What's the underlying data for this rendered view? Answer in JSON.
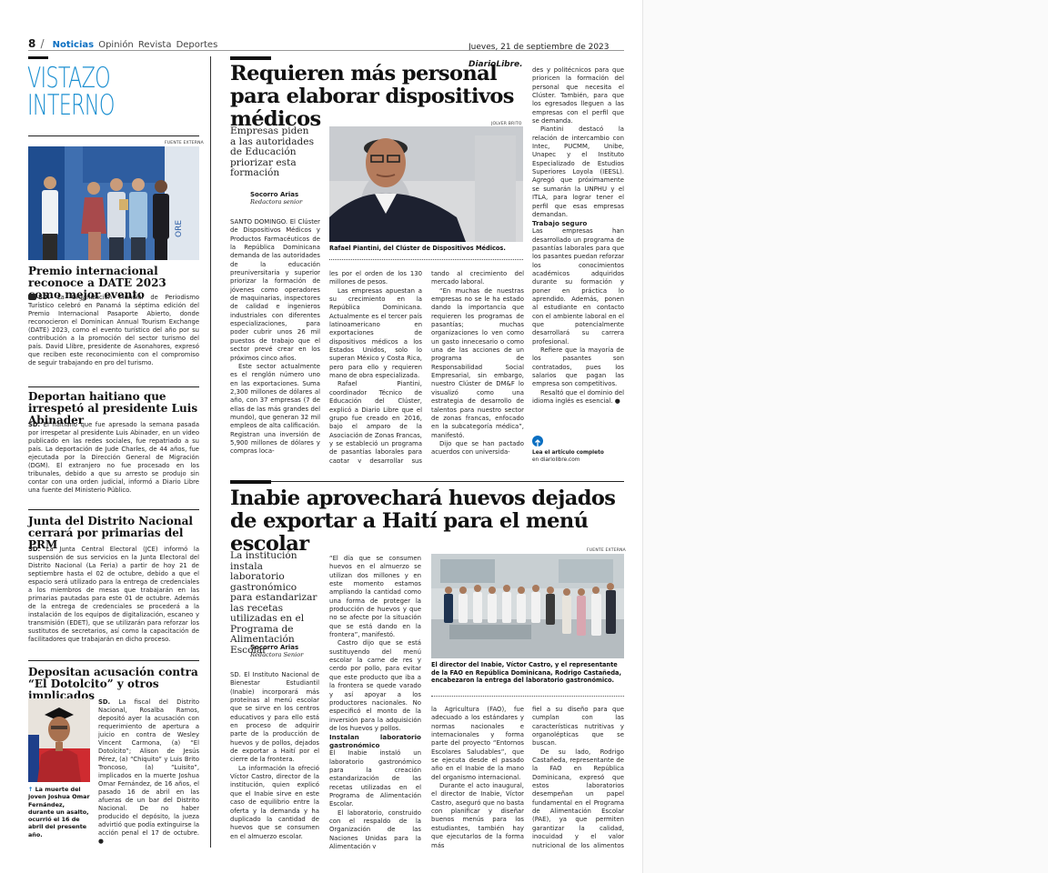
{
  "header": {
    "page_number": "8",
    "page_slash": "/",
    "nav": [
      "Noticias",
      "Opinión",
      "Revista",
      "Deportes"
    ],
    "date": "Jueves, 21 de septiembre de 2023",
    "brand": "DiarioLibre."
  },
  "sidebar": {
    "section_title_line1": "VISTAZO",
    "section_title_line2": "INTERNO",
    "photo_credit": "FUENTE EXTERNA",
    "stories": [
      {
        "headline": "Premio internacional reconoce a DATE 2023 como mejor evento",
        "tag": "SD.",
        "body": "La Organización Mundial de Periodismo Turístico celebró en Panamá la séptima edición del Premio Internacional Pasaporte Abierto, donde reconocieron el Dominican Annual Tourism Exchange (DATE) 2023, como el evento turístico del año por su contribución a la promoción del sector turismo del país. David Llibre, presidente de Asonahores, expresó que reciben este reconocimiento con el compromiso de seguir trabajando en pro del turismo."
      },
      {
        "headline": "Deportan haitiano que irrespetó al presidente Luis Abinader",
        "tag": "SD.",
        "body": "El haitiano que fue apresado la semana pasada por irrespetar al presidente Luis Abinader, en un video publicado en las redes sociales, fue repatriado a su país. La deportación de Jude Charles, de 44 años, fue ejecutada por la Dirección General de Migración (DGM). El extranjero no fue procesado en los tribunales, debido a que su arresto se produjo sin contar con una orden judicial, informó a Diario Libre una fuente del Ministerio Público."
      },
      {
        "headline": "Junta del Distrito Nacional cerrará por primarias del PRM",
        "tag": "SD.",
        "body": "La Junta Central Electoral (JCE) informó la suspensión de sus servicios en la Junta Electoral del Distrito Nacional (La Feria) a partir de hoy 21 de septiembre hasta el 02 de octubre, debido a que el espacio será utilizado para la entrega de credenciales a los miembros de mesas que trabajarán en las primarias pautadas para este 01 de octubre. Además de la entrega de credenciales se procederá a la instalación de los equipos de digitalización, escaneo y transmisión (EDET), que se utilizarán para reforzar los sustitutos de secretarios, así como la capacitación de facilitadores que trabajarán en dicho proceso."
      },
      {
        "headline": "Depositan acusación contra “El Dotolcito” y otros implicados",
        "tag": "SD.",
        "body": "La fiscal del Distrito Nacional, Rosalba Ramos, depositó ayer la acusación con requerimiento de apertura a juicio en contra de Wesley Vincent Carmona, (a) “El Dotolcito”; Alison de Jesús Pérez, (a) “Chiquito” y Luis Brito Troncoso, (a) “Luisito”, implicados en la muerte Joshua Omar Fernández, de 16 años, el pasado 16 de abril en las afueras de un bar del Distrito Nacional. De no haber producido el depósito, la jueza advirtió que podía extinguirse la acción penal el 17 de octubre. ●",
        "photo_caption": "La muerte del joven Joshua Omar Fernández, durante un asalto, ocurrió el 16 de abril del presente año."
      }
    ]
  },
  "article1": {
    "headline": "Requieren más personal para elaborar dispositivos médicos",
    "deck": "Empresas piden a las autoridades de Educación priorizar esta formación",
    "author": "Socorro Arias",
    "author_role": "Redactora senior",
    "photo_credit": "JOLVER BRITO",
    "photo_caption": "Rafael Piantini, del Clúster de Dispositivos Médicos.",
    "col1": [
      "SANTO DOMINGO. El Clúster de Dispositivos Médicos y Productos Farmacéuticos de la República Dominicana demanda de las autoridades de la educación preuniversitaria y superior priorizar la formación de jóvenes como operadores de maquinarias, inspectores de calidad e ingenieros industriales con diferentes especializaciones, para poder cubrir unos 26 mil puestos de trabajo que el sector prevé crear en los próximos cinco años.",
      "Este sector actualmente es el renglón número uno en las exportaciones. Suma 2,300 millones de dólares al año, con 37 empresas (7 de ellas de las más grandes del mundo), que generan 32 mil empleos de alta calificación. Registran una inversión de 5,900 millones de dólares y compras loca-"
    ],
    "col2": [
      "les por el orden de los 130 millones de pesos.",
      "Las empresas apuestan a su crecimiento en la República Dominicana. Actualmente es el tercer país latinoamericano en exportaciones de dispositivos médicos a los Estados Unidos, solo lo superan México y Costa Rica, pero para ello y requieren mano de obra especializada.",
      "Rafael Piantini, coordinador Técnico de Educación del Clúster, explicó a Diario Libre que el grupo fue creado en 2016, bajo el amparo de la Asociación de Zonas Francas, y se estableció un programa de pasantías laborales para captar y desarrollar sus talentos, apos-"
    ],
    "col3": [
      "tando al crecimiento del mercado laboral.",
      "“En muchas de nuestras empresas no se le ha estado dando la importancia que requieren los programas de pasantías; muchas organizaciones lo ven como un gasto innecesario o como una de las acciones de un programa de Responsabilidad Social Empresarial, sin embargo, nuestro Clúster de DM&F lo visualizó como una estrategia de desarrollo de talentos para nuestro sector de zonas francas, enfocado en la subcategoría médica”, manifestó.",
      "Dijo que se han pactado acuerdos con universida-"
    ],
    "col4": [
      "des y politécnicos para que prioricen la formación del personal que necesita el Clúster. También, para que los egresados lleguen a las empresas con el perfil que se demanda.",
      "Piantini destacó la relación de intercambio con Intec, PUCMM, Unibe, Unapec y el Instituto Especializado de Estudios Superiores Loyola (IEESL). Agregó que próximamente se sumarán la UNPHU y el ITLA, para lograr tener el perfil que esas empresas demandan."
    ],
    "subhead": "Trabajo seguro",
    "col4b": [
      "Las empresas han desarrollado un programa de pasantías laborales para que los pasantes puedan reforzar los conocimientos académicos adquiridos durante su formación y poner en práctica lo aprendido. Además, ponen al estudiante en contacto con el ambiente laboral en el que potencialmente desarrollará su carrera profesional.",
      "Refiere que la mayoría de los pasantes son contratados, pues los salarios que pagan las empresa son competitivos.",
      "Resaltó que el dominio del idioma inglés es esencial. ●"
    ],
    "read_more_line1": "Lea el artículo completo",
    "read_more_line2": "en diariolibre.com"
  },
  "article2": {
    "headline": "Inabie aprovechará huevos dejados de exportar a Haití para el menú escolar",
    "deck": "La institución instala laboratorio gastronómico para estandarizar las recetas utilizadas en el Programa de Alimentación Escolar",
    "author": "Socorro Arias",
    "author_role": "Redactora Senior",
    "photo_credit": "FUENTE EXTERNA",
    "photo_caption": "El director del Inabie, Víctor Castro, y el representante de la FAO en República Dominicana, Rodrigo Castañeda, encabezaron la entrega del laboratorio gastronómico.",
    "col1": [
      "SD. El Instituto Nacional de Bienestar Estudiantil (Inabie) incorporará más proteínas al menú escolar que se sirve en los centros educativos y para ello está en proceso de adquirir parte de la producción de huevos y de pollos, dejados de exportar a Haití por el cierre de la frontera.",
      "La información la ofreció Víctor Castro, director de la institución, quien explicó que el Inabie sirve en este caso de equilibrio entre la oferta y la demanda y ha duplicado la cantidad de huevos que se consumen en el almuerzo escolar."
    ],
    "col2": [
      "“El día que se consumen huevos en el almuerzo se utilizan dos millones y en este momento estamos ampliando la cantidad como una forma de proteger la producción de huevos y que no se afecte por la situación que se está dando en la frontera”, manifestó.",
      "Castro dijo que se está sustituyendo del menú escolar la carne de res y cerdo por pollo, para evitar que este producto que iba a la frontera se quede varado y así apoyar a los productores nacionales. No especificó el monto de la inversión para la adquisición de los huevos y pollos."
    ],
    "col2_subhead": "Instalan laboratorio gastronómico",
    "col2b": [
      "El Inabie instaló un laboratorio gastronómico para la creación estandarización de las recetas utilizadas en el Programa de Alimentación Escolar.",
      "El laboratorio, construido con el respaldo de la Organización de las Naciones Unidas para la Alimentación y"
    ],
    "col3": [
      "la Agricultura (FAO), fue adecuado a los estándares y normas nacionales e internacionales y forma parte del proyecto “Entornos Escolares Saludables”, que se ejecuta desde el pasado año en el Inabie de la mano del organismo internacional.",
      "Durante el acto inaugural, el director de Inabie, Víctor Castro, aseguró que no basta con planificar y diseñar buenos menús para los estudiantes, también hay que ejecutarlos de la forma más"
    ],
    "col4": [
      "fiel a su diseño para que cumplan con las características nutritivas y organolépticas que se buscan.",
      "De su lado, Rodrigo Castañeda, representante de la FAO en República Dominicana, expresó que estos laboratorios desempeñan un papel fundamental en el Programa de Alimentación Escolar (PAE), ya que permiten garantizar la calidad, inocuidad y el valor nutricional de los alimentos que se ofrecen a los estudiantes. ●"
    ]
  }
}
